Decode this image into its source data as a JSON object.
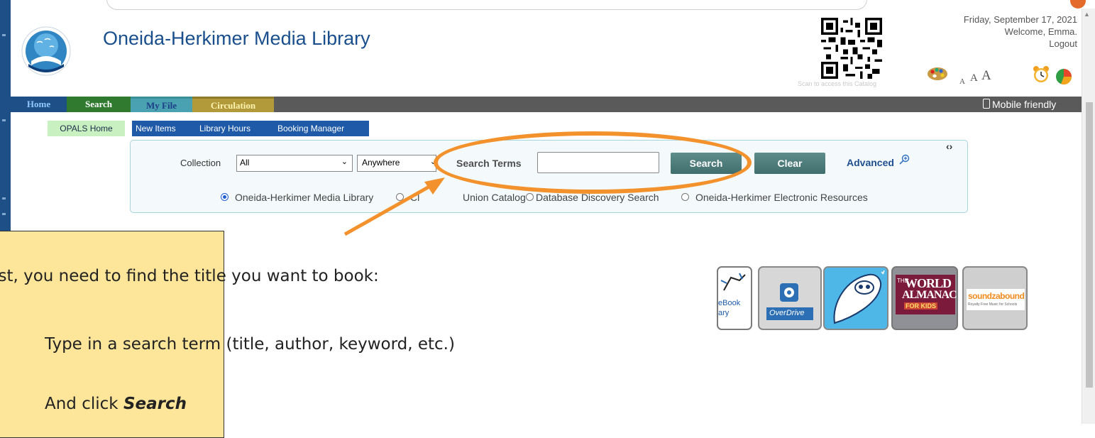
{
  "header": {
    "site_title": "Oneida-Herkimer Media Library",
    "qr_caption": "Scan to access this Catalog",
    "date": "Friday, September 17, 2021",
    "welcome": "Welcome, Emma.",
    "logout": "Logout",
    "font_sizes": [
      "A",
      "A",
      "A"
    ]
  },
  "nav": {
    "tabs": [
      "Home",
      "Search",
      "My File",
      "Circulation"
    ],
    "mobile_friendly": "Mobile friendly"
  },
  "subnav": {
    "items": [
      "OPALS Home",
      "New Items",
      "Library Hours",
      "Booking Manager"
    ]
  },
  "search": {
    "collection_label": "Collection",
    "collection_value": "All",
    "scope_value": "Anywhere",
    "search_terms_label": "Search Terms",
    "search_terms_value": "",
    "search_button": "Search",
    "clear_button": "Clear",
    "advanced_link": "Advanced",
    "radios": [
      {
        "label": "Oneida-Herkimer Media Library",
        "selected": true
      },
      {
        "label": "Cl",
        "selected": false
      },
      {
        "label": "Union Catalog",
        "selected": false
      },
      {
        "label": "Database Discovery Search",
        "selected": false
      },
      {
        "label": "Oneida-Herkimer Electronic Resources",
        "selected": false
      }
    ]
  },
  "callout": {
    "line1": "rst, you need to find the title you want to book:",
    "line2": "Type in a search term (title, author, keyword, etc.)",
    "line3_prefix": "And click ",
    "line3_emphasis": "Search"
  },
  "tiles": {
    "ebook": "eBook",
    "ebook_sub": "ary",
    "overdrive": "OverDrive",
    "almanac_the": "THE",
    "almanac_world": "WORLD",
    "almanac_almanac": "ALMANAC",
    "almanac_kids": "FOR KIDS",
    "soundzabound": "soundzabound",
    "soundzabound_sub": "Royalty Free Music for Schools"
  },
  "colors": {
    "brand_blue": "#1a4f8e",
    "annotation_orange": "#f3922c",
    "callout_yellow": "#fde69a",
    "button_teal": "#4f7e7d"
  },
  "icons": [
    "logo-icon",
    "qr-code-icon",
    "palette-icon",
    "alarm-clock-icon",
    "pie-chart-icon",
    "phone-icon",
    "zoom-in-icon",
    "chevron-down-icon"
  ]
}
